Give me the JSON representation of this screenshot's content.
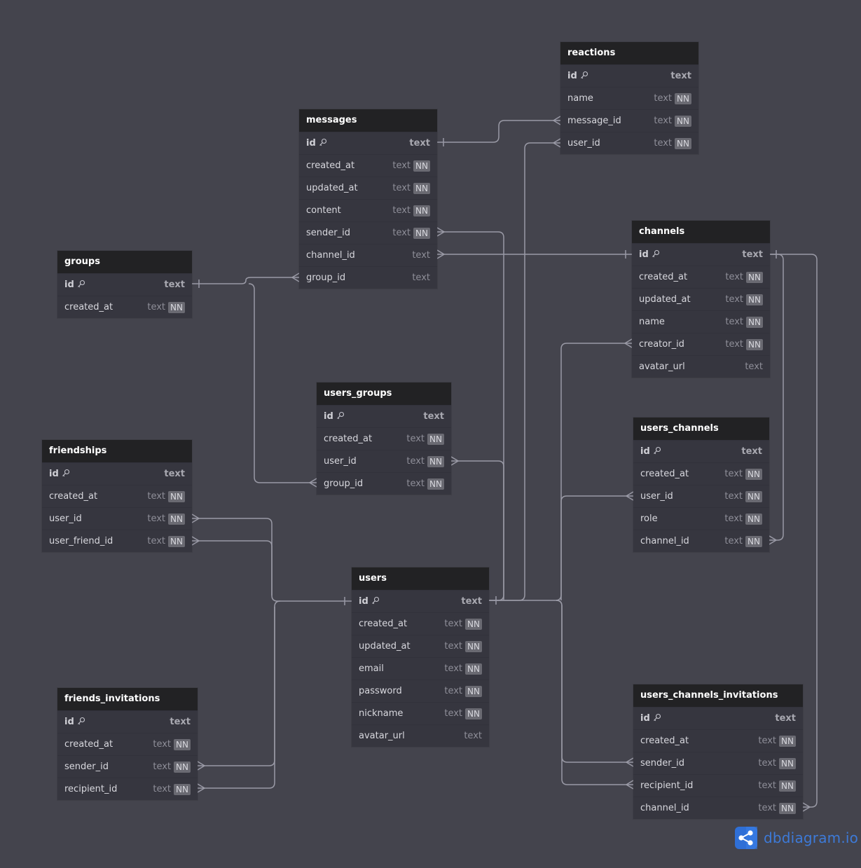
{
  "brand": {
    "name": "dbdiagram.io",
    "icon": "share-nodes-logo-icon",
    "color": "#2f6fd6"
  },
  "colors": {
    "canvas": "#44444d",
    "header": "#222224",
    "body": "#36363f",
    "connector": "#9a9aa6",
    "nn_badge": "#6a6a72"
  },
  "tables": [
    {
      "name": "reactions",
      "fields": [
        {
          "name": "id",
          "type": "text",
          "pk": true,
          "nn": false
        },
        {
          "name": "name",
          "type": "text",
          "pk": false,
          "nn": true
        },
        {
          "name": "message_id",
          "type": "text",
          "pk": false,
          "nn": true
        },
        {
          "name": "user_id",
          "type": "text",
          "pk": false,
          "nn": true
        }
      ]
    },
    {
      "name": "messages",
      "fields": [
        {
          "name": "id",
          "type": "text",
          "pk": true,
          "nn": false
        },
        {
          "name": "created_at",
          "type": "text",
          "pk": false,
          "nn": true
        },
        {
          "name": "updated_at",
          "type": "text",
          "pk": false,
          "nn": true
        },
        {
          "name": "content",
          "type": "text",
          "pk": false,
          "nn": true
        },
        {
          "name": "sender_id",
          "type": "text",
          "pk": false,
          "nn": true
        },
        {
          "name": "channel_id",
          "type": "text",
          "pk": false,
          "nn": false
        },
        {
          "name": "group_id",
          "type": "text",
          "pk": false,
          "nn": false
        }
      ]
    },
    {
      "name": "channels",
      "fields": [
        {
          "name": "id",
          "type": "text",
          "pk": true,
          "nn": false
        },
        {
          "name": "created_at",
          "type": "text",
          "pk": false,
          "nn": true
        },
        {
          "name": "updated_at",
          "type": "text",
          "pk": false,
          "nn": true
        },
        {
          "name": "name",
          "type": "text",
          "pk": false,
          "nn": true
        },
        {
          "name": "creator_id",
          "type": "text",
          "pk": false,
          "nn": true
        },
        {
          "name": "avatar_url",
          "type": "text",
          "pk": false,
          "nn": false
        }
      ]
    },
    {
      "name": "groups",
      "fields": [
        {
          "name": "id",
          "type": "text",
          "pk": true,
          "nn": false
        },
        {
          "name": "created_at",
          "type": "text",
          "pk": false,
          "nn": true
        }
      ]
    },
    {
      "name": "users_groups",
      "fields": [
        {
          "name": "id",
          "type": "text",
          "pk": true,
          "nn": false
        },
        {
          "name": "created_at",
          "type": "text",
          "pk": false,
          "nn": true
        },
        {
          "name": "user_id",
          "type": "text",
          "pk": false,
          "nn": true
        },
        {
          "name": "group_id",
          "type": "text",
          "pk": false,
          "nn": true
        }
      ]
    },
    {
      "name": "users_channels",
      "fields": [
        {
          "name": "id",
          "type": "text",
          "pk": true,
          "nn": false
        },
        {
          "name": "created_at",
          "type": "text",
          "pk": false,
          "nn": true
        },
        {
          "name": "user_id",
          "type": "text",
          "pk": false,
          "nn": true
        },
        {
          "name": "role",
          "type": "text",
          "pk": false,
          "nn": true
        },
        {
          "name": "channel_id",
          "type": "text",
          "pk": false,
          "nn": true
        }
      ]
    },
    {
      "name": "friendships",
      "fields": [
        {
          "name": "id",
          "type": "text",
          "pk": true,
          "nn": false
        },
        {
          "name": "created_at",
          "type": "text",
          "pk": false,
          "nn": true
        },
        {
          "name": "user_id",
          "type": "text",
          "pk": false,
          "nn": true
        },
        {
          "name": "user_friend_id",
          "type": "text",
          "pk": false,
          "nn": true
        }
      ]
    },
    {
      "name": "users",
      "fields": [
        {
          "name": "id",
          "type": "text",
          "pk": true,
          "nn": false
        },
        {
          "name": "created_at",
          "type": "text",
          "pk": false,
          "nn": true
        },
        {
          "name": "updated_at",
          "type": "text",
          "pk": false,
          "nn": true
        },
        {
          "name": "email",
          "type": "text",
          "pk": false,
          "nn": true
        },
        {
          "name": "password",
          "type": "text",
          "pk": false,
          "nn": true
        },
        {
          "name": "nickname",
          "type": "text",
          "pk": false,
          "nn": true
        },
        {
          "name": "avatar_url",
          "type": "text",
          "pk": false,
          "nn": false
        }
      ]
    },
    {
      "name": "friends_invitations",
      "fields": [
        {
          "name": "id",
          "type": "text",
          "pk": true,
          "nn": false
        },
        {
          "name": "created_at",
          "type": "text",
          "pk": false,
          "nn": true
        },
        {
          "name": "sender_id",
          "type": "text",
          "pk": false,
          "nn": true
        },
        {
          "name": "recipient_id",
          "type": "text",
          "pk": false,
          "nn": true
        }
      ]
    },
    {
      "name": "users_channels_invitations",
      "fields": [
        {
          "name": "id",
          "type": "text",
          "pk": true,
          "nn": false
        },
        {
          "name": "created_at",
          "type": "text",
          "pk": false,
          "nn": true
        },
        {
          "name": "sender_id",
          "type": "text",
          "pk": false,
          "nn": true
        },
        {
          "name": "recipient_id",
          "type": "text",
          "pk": false,
          "nn": true
        },
        {
          "name": "channel_id",
          "type": "text",
          "pk": false,
          "nn": true
        }
      ]
    }
  ],
  "nn_label": "NN",
  "relationships": [
    {
      "from": "reactions.message_id",
      "to": "messages.id",
      "type": "many-to-one"
    },
    {
      "from": "reactions.user_id",
      "to": "users.id",
      "type": "many-to-one"
    },
    {
      "from": "messages.sender_id",
      "to": "users.id",
      "type": "many-to-one"
    },
    {
      "from": "messages.channel_id",
      "to": "channels.id",
      "type": "many-to-one"
    },
    {
      "from": "messages.group_id",
      "to": "groups.id",
      "type": "many-to-one"
    },
    {
      "from": "channels.creator_id",
      "to": "users.id",
      "type": "many-to-one"
    },
    {
      "from": "users_groups.user_id",
      "to": "users.id",
      "type": "many-to-one"
    },
    {
      "from": "users_groups.group_id",
      "to": "groups.id",
      "type": "many-to-one"
    },
    {
      "from": "users_channels.user_id",
      "to": "users.id",
      "type": "many-to-one"
    },
    {
      "from": "users_channels.channel_id",
      "to": "channels.id",
      "type": "many-to-one"
    },
    {
      "from": "friendships.user_id",
      "to": "users.id",
      "type": "many-to-one"
    },
    {
      "from": "friendships.user_friend_id",
      "to": "users.id",
      "type": "many-to-one"
    },
    {
      "from": "friends_invitations.sender_id",
      "to": "users.id",
      "type": "many-to-one"
    },
    {
      "from": "friends_invitations.recipient_id",
      "to": "users.id",
      "type": "many-to-one"
    },
    {
      "from": "users_channels_invitations.sender_id",
      "to": "users.id",
      "type": "many-to-one"
    },
    {
      "from": "users_channels_invitations.recipient_id",
      "to": "users.id",
      "type": "many-to-one"
    },
    {
      "from": "users_channels_invitations.channel_id",
      "to": "channels.id",
      "type": "many-to-one"
    }
  ]
}
